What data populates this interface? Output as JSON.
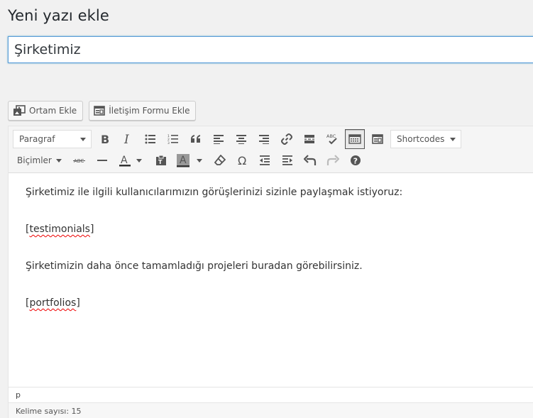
{
  "page": {
    "title": "Yeni yazı ekle"
  },
  "post": {
    "title_value": "Şirketimiz"
  },
  "media_buttons": [
    {
      "label": "Ortam Ekle",
      "icon": "media-icon"
    },
    {
      "label": "İletişim Formu Ekle",
      "icon": "form-icon"
    }
  ],
  "toolbar": {
    "format_select": "Paragraf",
    "shortcodes_select": "Shortcodes",
    "formats_menu": "Biçimler",
    "row1_icons": [
      "bold-icon",
      "italic-icon",
      "bullet-list-icon",
      "numbered-list-icon",
      "blockquote-icon",
      "align-left-icon",
      "align-center-icon",
      "align-right-icon",
      "link-icon",
      "read-more-icon",
      "spellcheck-icon",
      "toolbar-toggle-icon",
      "form-icon"
    ],
    "row2_icons": [
      "strikethrough-icon",
      "horizontal-line-icon",
      "text-color-icon",
      "paste-text-icon",
      "background-color-icon",
      "clear-formatting-icon",
      "special-character-icon",
      "outdent-icon",
      "indent-icon",
      "undo-icon",
      "redo-icon",
      "help-icon"
    ],
    "spellcheck_label": "ABC",
    "strike_label": "ABC",
    "text_color_letter": "A",
    "bg_color_letter": "A"
  },
  "content": {
    "paragraphs": [
      "Şirketimiz ile ilgili kullanıcılarımızın görüşlerinizi sizinle paylaşmak istiyoruz:",
      "[testimonials]",
      "Şirketimizin daha önce tamamladığı projeleri buradan görebilirsiniz.",
      "[portfolios]"
    ]
  },
  "path": "p",
  "status": {
    "word_count": "Kelime sayısı: 15"
  },
  "colors": {
    "accent": "#5b9dd9",
    "toolbar_bg": "#f5f5f5",
    "icon": "#555555"
  }
}
